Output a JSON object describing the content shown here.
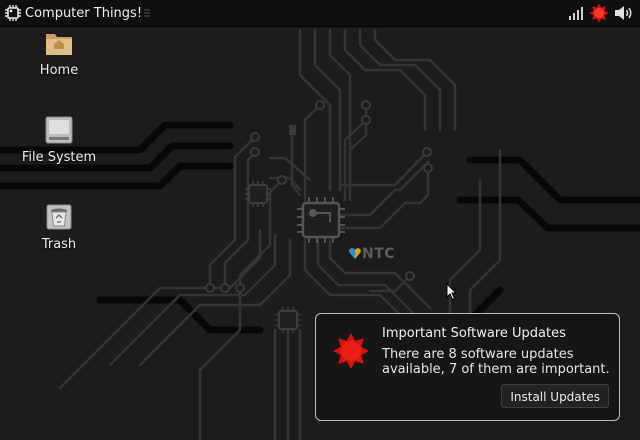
{
  "panel": {
    "menu_title": "Computer Things!",
    "menu_icon": "chip-icon",
    "tray": [
      "signal-icon",
      "update-alert-icon",
      "volume-icon"
    ]
  },
  "desktop": {
    "icons": [
      {
        "label": "Home",
        "icon": "home-folder-icon"
      },
      {
        "label": "File System",
        "icon": "drive-icon"
      },
      {
        "label": "Trash",
        "icon": "trash-icon"
      }
    ],
    "wallpaper_logo": "NTC"
  },
  "notification": {
    "title": "Important Software Updates",
    "body": "There are 8 software updates available, 7 of them are important.",
    "button": "Install Updates",
    "icon": "update-alert-icon",
    "accent": "#d9120f"
  }
}
